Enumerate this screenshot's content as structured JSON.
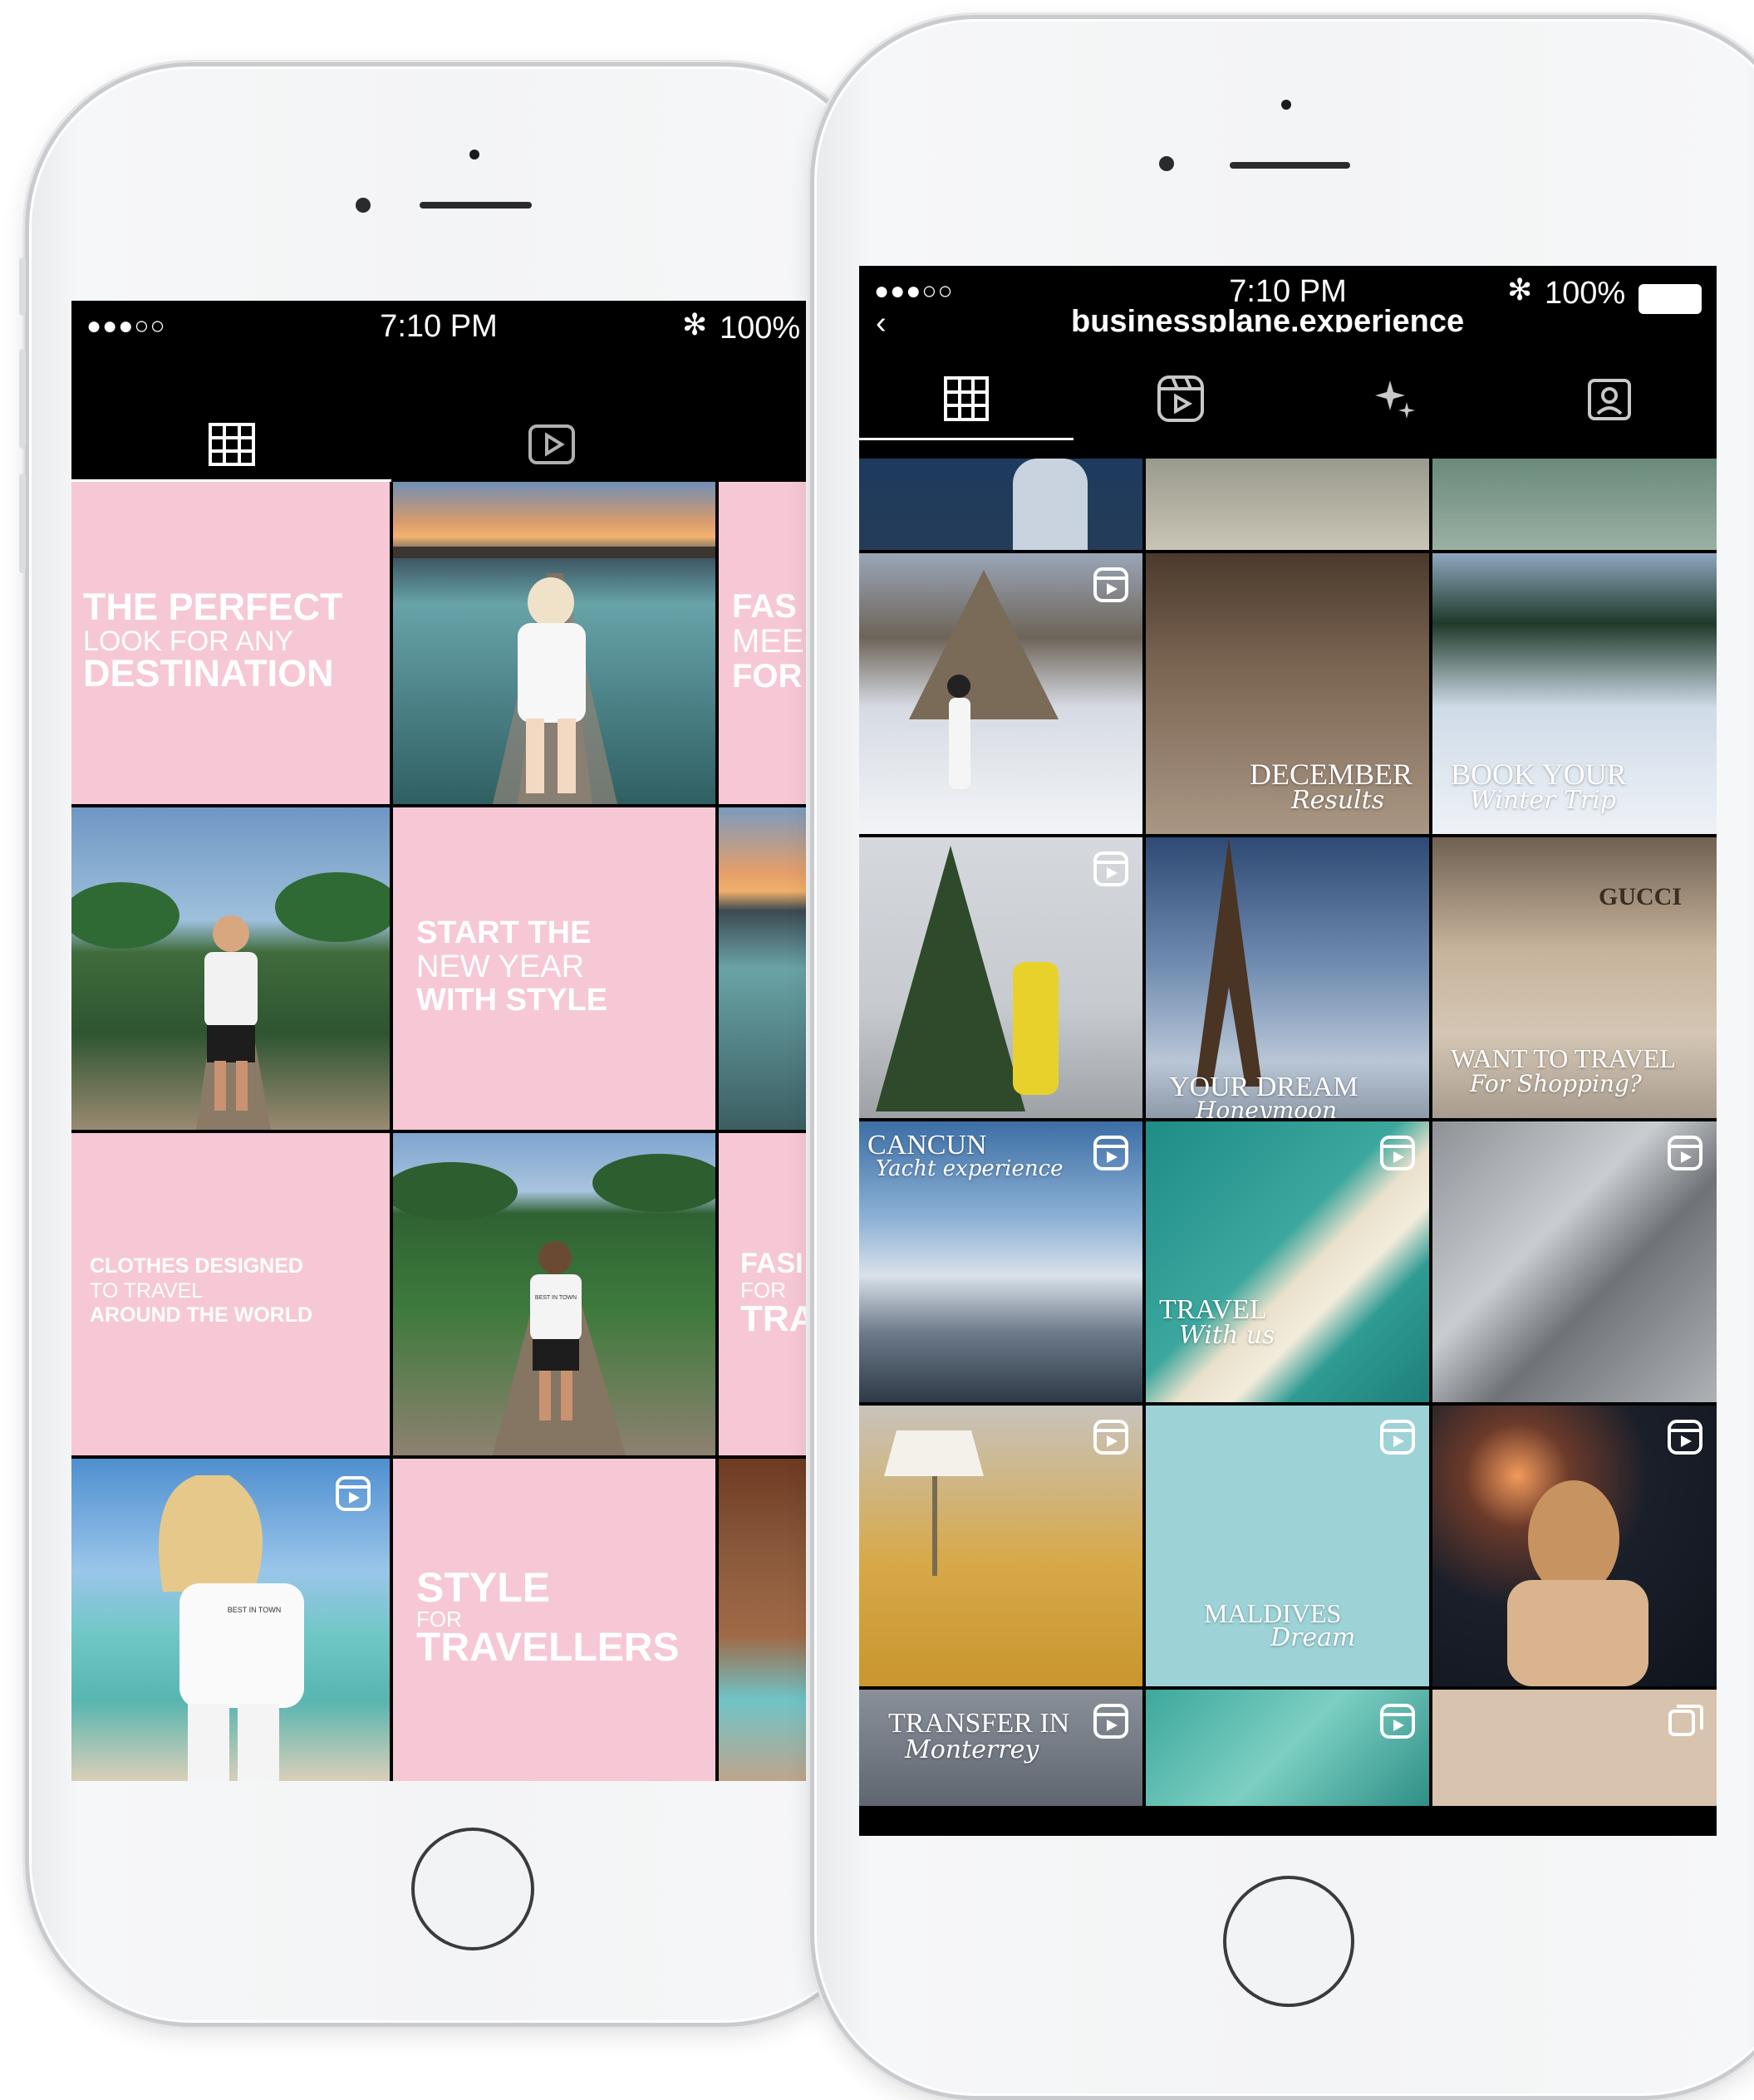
{
  "left_phone": {
    "status": {
      "signal": "●●●○○",
      "time": "7:10 PM",
      "bluetooth": "✻",
      "battery": "100%"
    },
    "tabs": [
      {
        "icon": "grid-icon",
        "active": true
      },
      {
        "icon": "reels-play-icon",
        "active": false
      }
    ],
    "posts": [
      {
        "type": "text",
        "line1": "THE PERFECT",
        "line2": "LOOK FOR ANY",
        "line3": "DESTINATION"
      },
      {
        "type": "photo",
        "scene": "pier-sunset"
      },
      {
        "type": "text-partial",
        "line1": "FAS",
        "line2": "MEE",
        "line3": "FOR"
      },
      {
        "type": "photo",
        "scene": "palm-path"
      },
      {
        "type": "text",
        "line1": "START THE",
        "line2": "NEW YEAR",
        "line3": "WITH STYLE"
      },
      {
        "type": "photo-partial",
        "scene": "pier-sunset"
      },
      {
        "type": "text",
        "line1": "CLOTHES DESIGNED",
        "line2": "TO TRAVEL",
        "line3": "AROUND THE WORLD"
      },
      {
        "type": "photo",
        "scene": "palm-walk",
        "shirt_text": "BEST IN TOWN"
      },
      {
        "type": "text-partial",
        "line1": "FASI",
        "line2": "FOR",
        "line3": "TRA"
      },
      {
        "type": "photo",
        "scene": "beach",
        "shirt_text": "BEST IN TOWN",
        "reel": true
      },
      {
        "type": "text",
        "line1": "STYLE",
        "line2": "FOR",
        "line3": "TRAVELLERS"
      },
      {
        "type": "photo-partial",
        "scene": "villa"
      }
    ]
  },
  "right_phone": {
    "status": {
      "signal": "●●●○○",
      "time": "7:10 PM",
      "bluetooth": "✻",
      "battery": "100%"
    },
    "header_username": "businessplane.experience",
    "tabs": [
      {
        "icon": "grid-icon",
        "active": true
      },
      {
        "icon": "reels-icon",
        "active": false
      },
      {
        "icon": "sparkles-icon",
        "active": false
      },
      {
        "icon": "tagged-person-icon",
        "active": false
      }
    ],
    "captions": {
      "december": "DECEMBER",
      "december_sub": "Results",
      "book": "BOOK YOUR",
      "book_sub": "Winter Trip",
      "dream": "YOUR DREAM",
      "dream_sub": "Honeymoon",
      "shopping": "WANT TO TRAVEL",
      "shopping_sub": "For Shopping?",
      "cancun": "CANCUN",
      "cancun_sub": "Yacht experience",
      "travel": "TRAVEL",
      "travel_sub": "With us",
      "maldives": "MALDIVES",
      "maldives_sub": "Dream",
      "transfer": "TRANSFER IN",
      "transfer_sub": "Monterrey",
      "gucci": "GUCCI"
    }
  },
  "colors": {
    "pink": "#f6c8d6",
    "screen_black": "#000000",
    "maldives_teal": "#9dd3d7",
    "beige": "#d8c3ae"
  }
}
